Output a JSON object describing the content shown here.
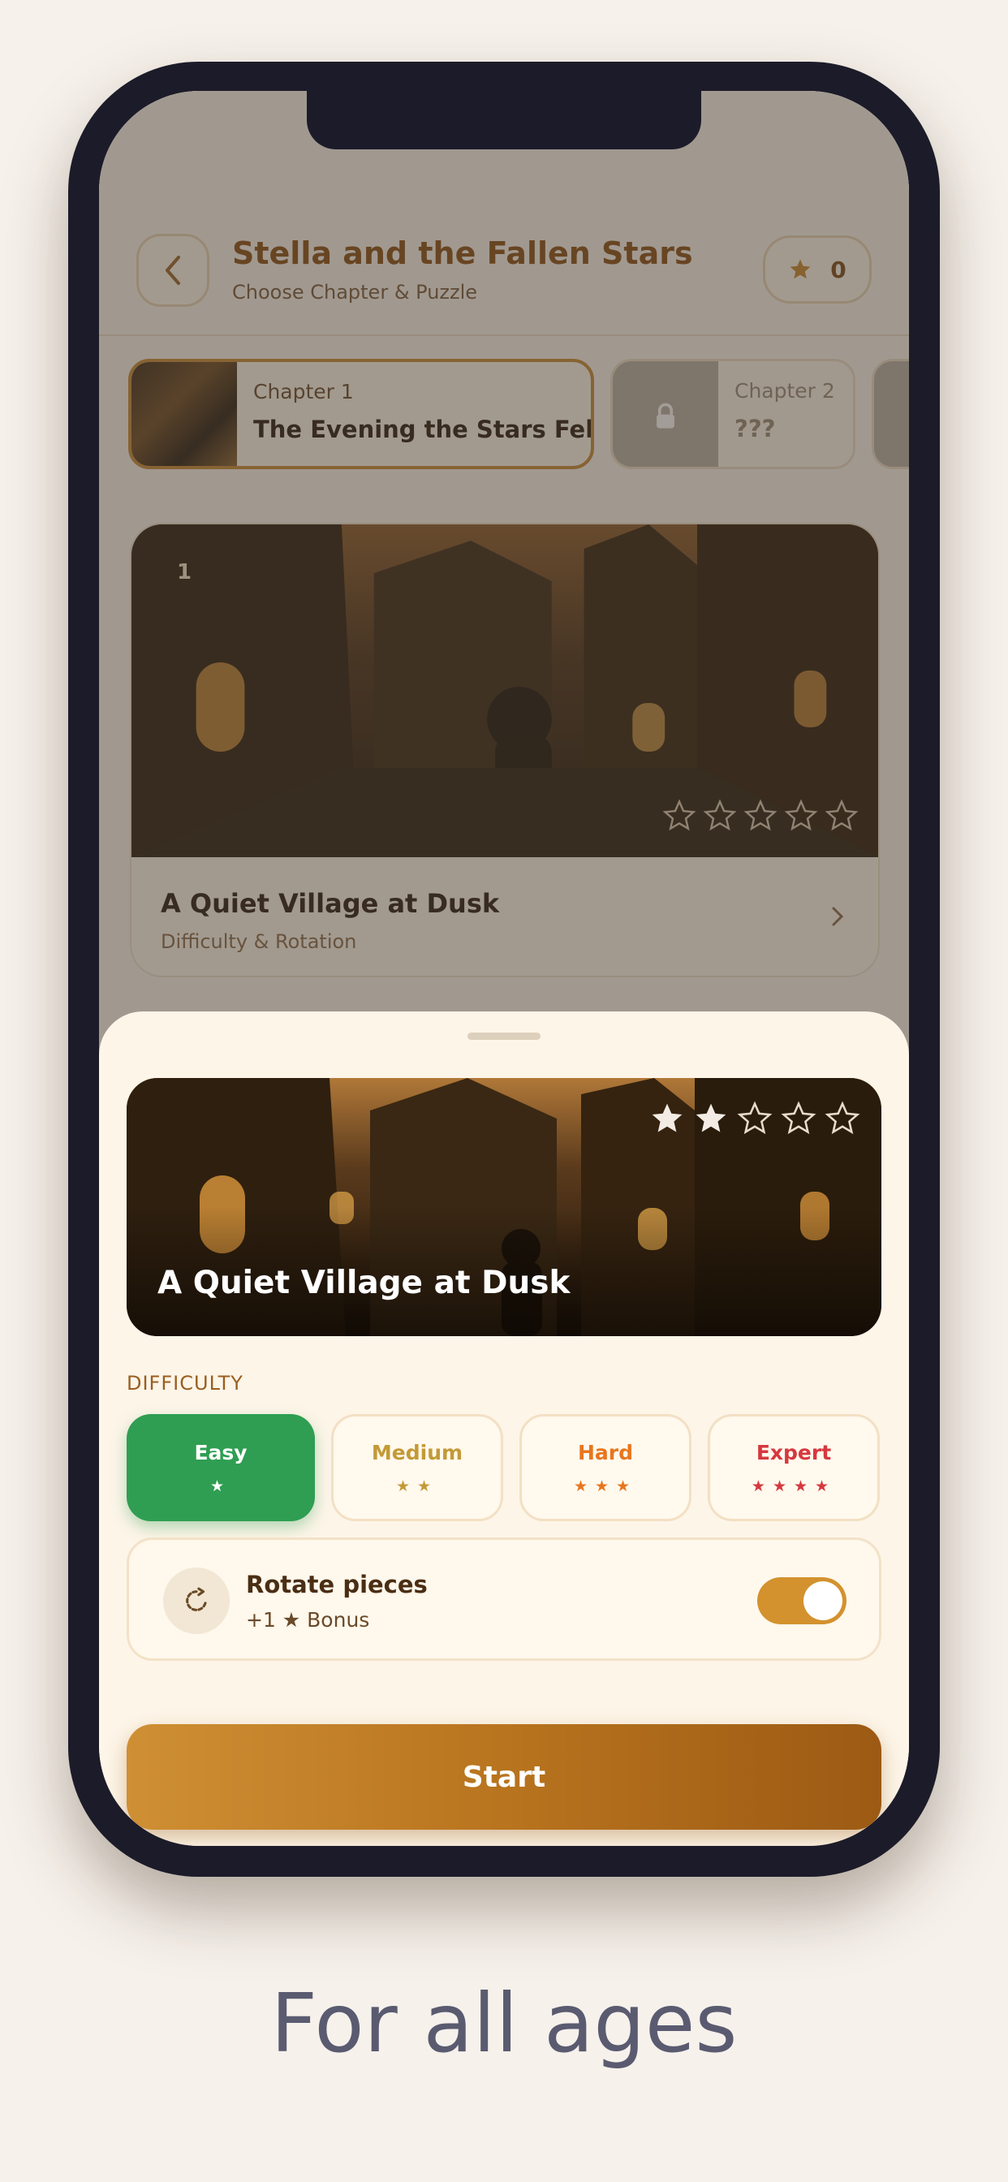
{
  "header": {
    "title": "Stella and the Fallen Stars",
    "subtitle": "Choose Chapter & Puzzle",
    "star_count": "0"
  },
  "chapters": [
    {
      "label": "Chapter 1",
      "name": "The Evening the Stars Fell",
      "state": "selected"
    },
    {
      "label": "Chapter 2",
      "name": "???",
      "state": "locked"
    }
  ],
  "puzzle_card": {
    "number": "1",
    "title": "A Quiet Village at Dusk",
    "subtitle": "Difficulty & Rotation",
    "stars_earned": 0,
    "stars_total": 5
  },
  "sheet": {
    "title": "A Quiet Village at Dusk",
    "stars_earned": 2,
    "stars_total": 5,
    "difficulty_label": "DIFFICULTY",
    "difficulties": [
      {
        "label": "Easy",
        "stars": "★",
        "selected": true,
        "color": "#2f9e52"
      },
      {
        "label": "Medium",
        "stars": "★★",
        "selected": false,
        "color": "#c39a36"
      },
      {
        "label": "Hard",
        "stars": "★★★",
        "selected": false,
        "color": "#e8761e"
      },
      {
        "label": "Expert",
        "stars": "★★★★",
        "selected": false,
        "color": "#d6383e"
      }
    ],
    "rotate": {
      "title": "Rotate pieces",
      "bonus": "+1 ★ Bonus",
      "enabled": true
    },
    "start_label": "Start"
  },
  "tagline": "For all ages",
  "colors": {
    "accent": "#c8872c",
    "selected_green": "#2f9e52",
    "background": "#f6f1eb",
    "phone_frame": "#1c1b29"
  }
}
